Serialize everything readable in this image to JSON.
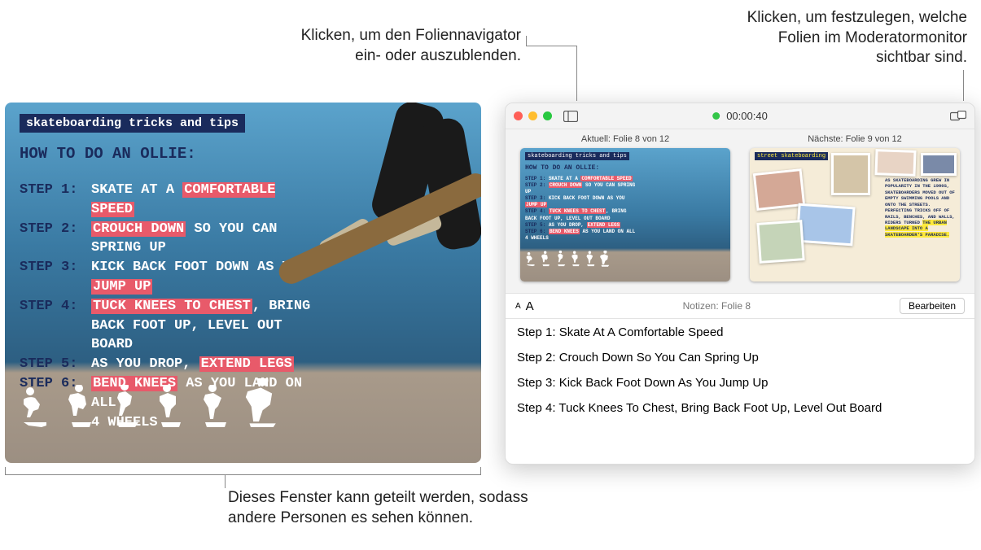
{
  "callouts": {
    "navigator": "Klicken, um den Foliennavigator\nein- oder auszublenden.",
    "monitor": "Klicken, um festzulegen, welche\nFolien im Moderatormonitor\nsichtbar sind.",
    "share": "Dieses Fenster kann geteilt werden, sodass\nandere Personen es sehen können."
  },
  "slide": {
    "badge": "skateboarding tricks and tips",
    "title": "HOW TO DO AN OLLIE:",
    "steps": [
      {
        "label": "STEP 1:",
        "pre": "SKATE AT A ",
        "hl": "COMFORTABLE SPEED",
        "post": ""
      },
      {
        "label": "STEP 2:",
        "pre": "",
        "hl": "CROUCH DOWN",
        "post": " SO YOU CAN\nSPRING UP"
      },
      {
        "label": "STEP 3:",
        "pre": "KICK BACK FOOT DOWN AS YOU\n",
        "hl": "JUMP UP",
        "post": ""
      },
      {
        "label": "STEP 4:",
        "pre": "",
        "hl": "TUCK KNEES TO CHEST",
        "post": ", BRING\nBACK FOOT UP, LEVEL OUT BOARD"
      },
      {
        "label": "STEP 5:",
        "pre": "AS YOU DROP, ",
        "hl": "EXTEND LEGS",
        "post": ""
      },
      {
        "label": "STEP 6:",
        "pre": "",
        "hl": "BEND KNEES",
        "post": " AS YOU LAND ON ALL\n4 WHEELS"
      }
    ]
  },
  "presenter": {
    "timer": "00:00:40",
    "current_label": "Aktuell: Folie 8 von 12",
    "next_label": "Nächste: Folie 9 von 12",
    "next_badge": "street skateboarding",
    "next_text": "AS SKATEBOARDING\nGREW IN POPULARITY\nIN THE 1980S,\nSKATEBOARDERS MOVED\nOUT OF EMPTY SWIMMING\nPOOLS AND ONTO THE\nSTREETS. PERFECTING\nTRICKS OFF OF RAILS,\nBENCHES, AND WALLS,\nRIDERS TURNED ",
    "next_hl": "THE\nURBAN LANDSCAPE INTO\nA SKATEBOARDER'S\nPARADISE.",
    "notes_title": "Notizen: Folie 8",
    "edit_label": "Bearbeiten",
    "notes": [
      "Step 1: Skate At A Comfortable Speed",
      "Step 2: Crouch Down So You Can Spring Up",
      "Step 3: Kick Back Foot Down As You Jump Up",
      "Step 4: Tuck Knees To Chest, Bring Back Foot Up, Level Out Board"
    ]
  }
}
